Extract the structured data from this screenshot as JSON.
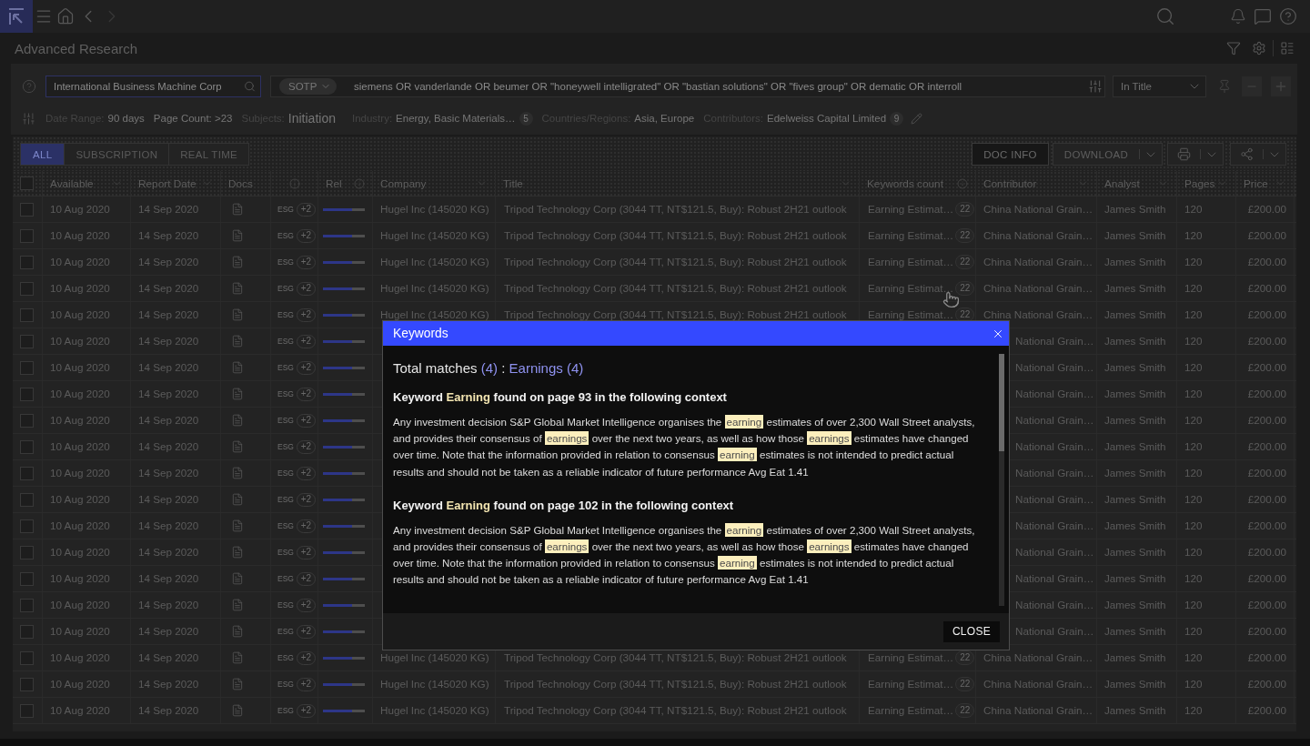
{
  "top_bar": {
    "back": {
      "disabled": false
    },
    "forward": {
      "disabled": true
    }
  },
  "page_title": "Advanced Research",
  "search": {
    "value": "International Business Machine Corp"
  },
  "query": {
    "operator": "SOTP",
    "value": "siemens OR vanderlande OR beumer OR \"honeywell intelligrated\" OR \"bastian solutions\" OR \"fives group\" OR dematic OR interroll"
  },
  "scope": {
    "value": "In Title"
  },
  "filters": [
    {
      "kind": "text",
      "label": "Date Range:",
      "value": "90 days"
    },
    {
      "kind": "text",
      "value": "Page Count: >23"
    },
    {
      "kind": "large",
      "label": "Subjects:",
      "value": "Initiation"
    },
    {
      "kind": "text",
      "label": "Industry:",
      "value": "Energy, Basic Materials…",
      "count": "5"
    },
    {
      "kind": "text",
      "label": "Countries/Regions:",
      "value": "Asia, Europe"
    },
    {
      "kind": "text",
      "label": "Contributors:",
      "value": "Edelweiss Capital Limited",
      "count": "9"
    }
  ],
  "tabs": [
    {
      "label": "ALL",
      "selected": true
    },
    {
      "label": "SUBSCRIPTION",
      "selected": false
    },
    {
      "label": "REAL TIME",
      "selected": false
    }
  ],
  "toolbar": {
    "doc_info": "DOC INFO",
    "download": "DOWNLOAD"
  },
  "table": {
    "select_all": {
      "checked": false
    },
    "columns": [
      {
        "label": "Available",
        "sortable": true,
        "info": false
      },
      {
        "label": "Report Date",
        "sortable": true,
        "info": false
      },
      {
        "label": "Docs",
        "sortable": false,
        "info": false
      },
      {
        "sortable": false,
        "info": true
      },
      {
        "label": "Rel",
        "sortable": false,
        "info": true
      },
      {
        "label": "Company",
        "sortable": true,
        "info": false
      },
      {
        "label": "Title",
        "sortable": true,
        "info": false
      },
      {
        "label": "Keywords count",
        "sortable": false,
        "info": true
      },
      {
        "label": "Contributor",
        "sortable": true,
        "info": false
      },
      {
        "label": "Analyst",
        "sortable": true,
        "info": false
      },
      {
        "label": "Pages",
        "sortable": true,
        "info": false
      },
      {
        "label": "Price",
        "sortable": true,
        "info": false
      }
    ],
    "rows": [
      {
        "checked": false,
        "available": "10 Aug 2020",
        "report_date": "14 Sep 2020",
        "tag": "ESG",
        "more": "+2",
        "level": 0.69,
        "company": "Hugel Inc (145020 KG)",
        "title": "Tripod Technology Corp (3044 TT, NT$121.5, Buy): Robust 2H21 outlook",
        "keywords": "Earning Estimat…",
        "keyword_count": "22",
        "contributor": "China National Grain…",
        "analyst": "James Smith",
        "pages": "120",
        "price": "£200.00"
      },
      {
        "checked": false,
        "available": "10 Aug 2020",
        "report_date": "14 Sep 2020",
        "tag": "ESG",
        "more": "+2",
        "level": 0.69,
        "company": "Hugel Inc (145020 KG)",
        "title": "Tripod Technology Corp (3044 TT, NT$121.5, Buy): Robust 2H21 outlook",
        "keywords": "Earning Estimat…",
        "keyword_count": "22",
        "contributor": "China National Grain…",
        "analyst": "James Smith",
        "pages": "120",
        "price": "£200.00"
      },
      {
        "checked": false,
        "available": "10 Aug 2020",
        "report_date": "14 Sep 2020",
        "tag": "ESG",
        "more": "+2",
        "level": 0.69,
        "company": "Hugel Inc (145020 KG)",
        "title": "Tripod Technology Corp (3044 TT, NT$121.5, Buy): Robust 2H21 outlook",
        "keywords": "Earning Estimat…",
        "keyword_count": "22",
        "contributor": "China National Grain…",
        "analyst": "James Smith",
        "pages": "120",
        "price": "£200.00"
      },
      {
        "checked": false,
        "available": "10 Aug 2020",
        "report_date": "14 Sep 2020",
        "tag": "ESG",
        "more": "+2",
        "level": 0.69,
        "company": "Hugel Inc (145020 KG)",
        "title": "Tripod Technology Corp (3044 TT, NT$121.5, Buy): Robust 2H21 outlook",
        "keywords": "Earning Estimat…",
        "keyword_count": "22",
        "contributor": "China National Grain…",
        "analyst": "James Smith",
        "pages": "120",
        "price": "£200.00"
      },
      {
        "checked": false,
        "available": "10 Aug 2020",
        "report_date": "14 Sep 2020",
        "tag": "ESG",
        "more": "+2",
        "level": 0.69,
        "company": "Hugel Inc (145020 KG)",
        "title": "Tripod Technology Corp (3044 TT, NT$121.5, Buy): Robust 2H21 outlook",
        "keywords": "Earning Estimat…",
        "keyword_count": "22",
        "contributor": "China National Grain…",
        "analyst": "James Smith",
        "pages": "120",
        "price": "£200.00"
      },
      {
        "checked": false,
        "available": "10 Aug 2020",
        "report_date": "14 Sep 2020",
        "tag": "ESG",
        "more": "+2",
        "level": 0.69,
        "contributor": "National Grain…",
        "analyst": "James Smith",
        "pages": "120",
        "price": "£200.00"
      },
      {
        "checked": false,
        "available": "10 Aug 2020",
        "report_date": "14 Sep 2020",
        "tag": "ESG",
        "more": "+2",
        "level": 0.69,
        "contributor": "National Grain…",
        "analyst": "James Smith",
        "pages": "120",
        "price": "£200.00"
      },
      {
        "checked": false,
        "available": "10 Aug 2020",
        "report_date": "14 Sep 2020",
        "tag": "ESG",
        "more": "+2",
        "level": 0.69,
        "contributor": "National Grain…",
        "analyst": "James Smith",
        "pages": "120",
        "price": "£200.00"
      },
      {
        "checked": false,
        "available": "10 Aug 2020",
        "report_date": "14 Sep 2020",
        "tag": "ESG",
        "more": "+2",
        "level": 0.69,
        "contributor": "National Grain…",
        "analyst": "James Smith",
        "pages": "120",
        "price": "£200.00"
      },
      {
        "checked": false,
        "available": "10 Aug 2020",
        "report_date": "14 Sep 2020",
        "tag": "ESG",
        "more": "+2",
        "level": 0.69,
        "contributor": "National Grain…",
        "analyst": "James Smith",
        "pages": "120",
        "price": "£200.00"
      },
      {
        "checked": false,
        "available": "10 Aug 2020",
        "report_date": "14 Sep 2020",
        "tag": "ESG",
        "more": "+2",
        "level": 0.69,
        "contributor": "National Grain…",
        "analyst": "James Smith",
        "pages": "120",
        "price": "£200.00"
      },
      {
        "checked": false,
        "available": "10 Aug 2020",
        "report_date": "14 Sep 2020",
        "tag": "ESG",
        "more": "+2",
        "level": 0.69,
        "contributor": "National Grain…",
        "analyst": "James Smith",
        "pages": "120",
        "price": "£200.00"
      },
      {
        "checked": false,
        "available": "10 Aug 2020",
        "report_date": "14 Sep 2020",
        "tag": "ESG",
        "more": "+2",
        "level": 0.69,
        "contributor": "National Grain…",
        "analyst": "James Smith",
        "pages": "120",
        "price": "£200.00"
      },
      {
        "checked": false,
        "available": "10 Aug 2020",
        "report_date": "14 Sep 2020",
        "tag": "ESG",
        "more": "+2",
        "level": 0.69,
        "contributor": "National Grain…",
        "analyst": "James Smith",
        "pages": "120",
        "price": "£200.00"
      },
      {
        "checked": false,
        "available": "10 Aug 2020",
        "report_date": "14 Sep 2020",
        "tag": "ESG",
        "more": "+2",
        "level": 0.69,
        "contributor": "National Grain…",
        "analyst": "James Smith",
        "pages": "120",
        "price": "£200.00"
      },
      {
        "checked": false,
        "available": "10 Aug 2020",
        "report_date": "14 Sep 2020",
        "tag": "ESG",
        "more": "+2",
        "level": 0.69,
        "contributor": "National Grain…",
        "analyst": "James Smith",
        "pages": "120",
        "price": "£200.00"
      },
      {
        "checked": false,
        "available": "10 Aug 2020",
        "report_date": "14 Sep 2020",
        "tag": "ESG",
        "more": "+2",
        "level": 0.69,
        "contributor": "National Grain…",
        "analyst": "James Smith",
        "pages": "120",
        "price": "£200.00"
      },
      {
        "checked": false,
        "available": "10 Aug 2020",
        "report_date": "14 Sep 2020",
        "tag": "ESG",
        "more": "+2",
        "level": 0.69,
        "company": "Hugel Inc (145020 KG)",
        "title": "Tripod Technology Corp (3044 TT, NT$121.5, Buy): Robust 2H21 outlook",
        "keywords": "Earning Estimat…",
        "keyword_count": "22",
        "contributor": "China National Grain…",
        "analyst": "James Smith",
        "pages": "120",
        "price": "£200.00"
      },
      {
        "checked": false,
        "available": "10 Aug 2020",
        "report_date": "14 Sep 2020",
        "tag": "ESG",
        "more": "+2",
        "level": 0.69,
        "company": "Hugel Inc (145020 KG)",
        "title": "Tripod Technology Corp (3044 TT, NT$121.5, Buy): Robust 2H21 outlook",
        "keywords": "Earning Estimat…",
        "keyword_count": "22",
        "contributor": "China National Grain…",
        "analyst": "James Smith",
        "pages": "120",
        "price": "£200.00"
      },
      {
        "checked": false,
        "available": "10 Aug 2020",
        "report_date": "14 Sep 2020",
        "tag": "ESG",
        "more": "+2",
        "level": 0.69,
        "company": "Hugel Inc (145020 KG)",
        "title": "Tripod Technology Corp (3044 TT, NT$121.5, Buy): Robust 2H21 outlook",
        "keywords": "Earning Estimat…",
        "keyword_count": "22",
        "contributor": "China National Grain…",
        "analyst": "James Smith",
        "pages": "120",
        "price": "£200.00"
      }
    ]
  },
  "dialog": {
    "title": "Keywords",
    "summary": {
      "label": "Total matches",
      "count": "(4)",
      "separator": ":",
      "breakdown": "Earnings (4)"
    },
    "contexts": [
      {
        "heading": {
          "prefix": "Keyword",
          "keyword": "Earning",
          "suffix": "found on page 93 in the following context"
        },
        "segments": [
          {
            "text": "Any investment decision S&P Global Market Intelligence organises the ",
            "highlighted": false
          },
          {
            "text": "earning",
            "highlighted": true
          },
          {
            "text": " estimates of over 2,300 Wall Street analysts, and provides their consensus of ",
            "highlighted": false
          },
          {
            "text": "earnings",
            "highlighted": true
          },
          {
            "text": " over the next two years, as well as how those ",
            "highlighted": false
          },
          {
            "text": "earnings",
            "highlighted": true
          },
          {
            "text": " estimates have changed over time. Note that the information provided in relation to consensus ",
            "highlighted": false
          },
          {
            "text": "earning",
            "highlighted": true
          },
          {
            "text": " estimates is not intended to predict actual results and should not be taken as a reliable indicator of future performance Avg Eat 1.41",
            "highlighted": false
          }
        ]
      },
      {
        "heading": {
          "prefix": "Keyword",
          "keyword": "Earning",
          "suffix": "found on page 102 in the following context"
        },
        "segments": [
          {
            "text": "Any investment decision S&P Global Market Intelligence organises the ",
            "highlighted": false
          },
          {
            "text": "earning",
            "highlighted": true
          },
          {
            "text": " estimates of over 2,300 Wall Street analysts, and provides their consensus of ",
            "highlighted": false
          },
          {
            "text": "earnings",
            "highlighted": true
          },
          {
            "text": " over the next two years, as well as how those ",
            "highlighted": false
          },
          {
            "text": "earnings",
            "highlighted": true
          },
          {
            "text": " estimates have changed over time. Note that the information provided in relation to consensus ",
            "highlighted": false
          },
          {
            "text": "earning",
            "highlighted": true
          },
          {
            "text": " estimates is not intended to predict actual results and should not be taken as a reliable indicator of future performance Avg Eat 1.41",
            "highlighted": false
          }
        ]
      }
    ],
    "close_button": "CLOSE"
  }
}
